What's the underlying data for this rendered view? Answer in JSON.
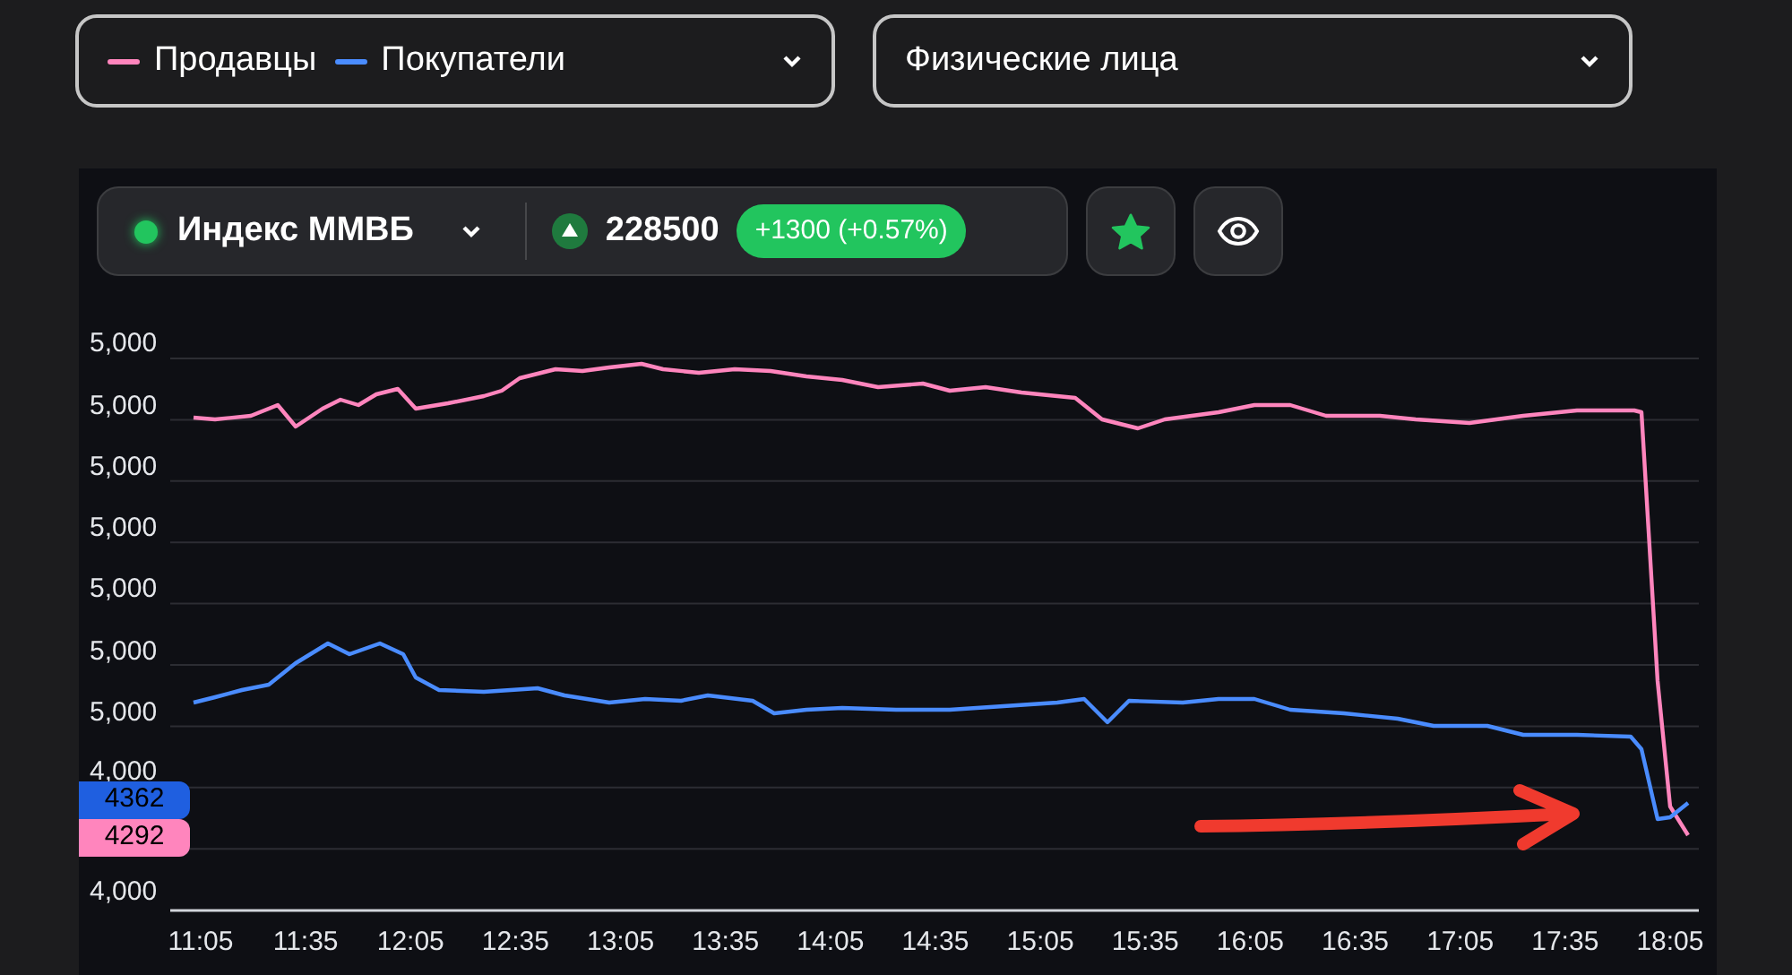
{
  "series_select": {
    "items": [
      {
        "label": "Продавцы",
        "color": "#ff85bd"
      },
      {
        "label": "Покупатели",
        "color": "#4a8cff"
      }
    ]
  },
  "filter_select": {
    "value": "Физические лица"
  },
  "toolbar": {
    "instrument": "Индекс ММВБ",
    "price": "228500",
    "change": "+1300 (+0.57%)",
    "favorite": true
  },
  "chart": {
    "y_labels": [
      "5,000",
      "5,000",
      "5,000",
      "5,000",
      "5,000",
      "5,000",
      "5,000",
      "4,000",
      "4,000"
    ],
    "x_labels": [
      "11:05",
      "11:35",
      "12:05",
      "12:35",
      "13:05",
      "13:35",
      "14:05",
      "14:35",
      "15:05",
      "15:35",
      "16:05",
      "16:35",
      "17:05",
      "17:35",
      "18:05"
    ],
    "price_tags": [
      {
        "label": "4362",
        "color": "#1f5fe0"
      },
      {
        "label": "4292",
        "color": "#ff85bd"
      }
    ]
  }
}
